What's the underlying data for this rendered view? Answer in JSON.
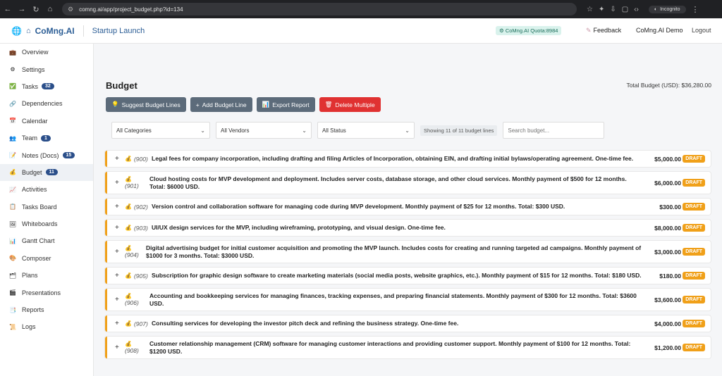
{
  "browser": {
    "url": "comng.ai/app/project_budget.php?id=134",
    "incognito_label": "Incognito"
  },
  "header": {
    "brand": "CoMng.AI",
    "project": "Startup Launch",
    "quota": "CoMng.AI Quota:8984",
    "feedback": "Feedback",
    "user": "CoMng.AI Demo",
    "logout": "Logout"
  },
  "sidebar": {
    "items": [
      {
        "label": "Overview",
        "icon": "briefcase-icon",
        "glyph": "💼",
        "badge": ""
      },
      {
        "label": "Settings",
        "icon": "gear-icon",
        "glyph": "⚙",
        "badge": ""
      },
      {
        "label": "Tasks",
        "icon": "checkbox-icon",
        "glyph": "✅",
        "badge": "32"
      },
      {
        "label": "Dependencies",
        "icon": "dependencies-icon",
        "glyph": "🔗",
        "badge": ""
      },
      {
        "label": "Calendar",
        "icon": "calendar-icon",
        "glyph": "📅",
        "badge": ""
      },
      {
        "label": "Team",
        "icon": "team-icon",
        "glyph": "👥",
        "badge": "1"
      },
      {
        "label": "Notes (Docs)",
        "icon": "notes-icon",
        "glyph": "📝",
        "badge": "15"
      },
      {
        "label": "Budget",
        "icon": "moneybag-icon",
        "glyph": "💰",
        "badge": "11"
      },
      {
        "label": "Activities",
        "icon": "activities-icon",
        "glyph": "📈",
        "badge": ""
      },
      {
        "label": "Tasks Board",
        "icon": "board-icon",
        "glyph": "📋",
        "badge": ""
      },
      {
        "label": "Whiteboards",
        "icon": "whiteboard-icon",
        "glyph": "🖼",
        "badge": ""
      },
      {
        "label": "Gantt Chart",
        "icon": "gantt-icon",
        "glyph": "📊",
        "badge": ""
      },
      {
        "label": "Composer",
        "icon": "composer-icon",
        "glyph": "🎨",
        "badge": ""
      },
      {
        "label": "Plans",
        "icon": "plans-icon",
        "glyph": "🗂",
        "badge": ""
      },
      {
        "label": "Presentations",
        "icon": "presentation-icon",
        "glyph": "🎬",
        "badge": ""
      },
      {
        "label": "Reports",
        "icon": "reports-icon",
        "glyph": "📑",
        "badge": ""
      },
      {
        "label": "Logs",
        "icon": "logs-icon",
        "glyph": "📜",
        "badge": ""
      }
    ],
    "active": "Budget"
  },
  "page": {
    "title": "Budget",
    "total": "Total Budget (USD): $36,280.00",
    "buttons": {
      "suggest": "Suggest Budget Lines",
      "add": "Add Budget Line",
      "export": "Export Report",
      "delete": "Delete Multiple"
    },
    "filters": {
      "categories": "All Categories",
      "vendors": "All Vendors",
      "status": "All Status",
      "showing": "Showing 11 of 11 budget lines",
      "search_placeholder": "Search budget..."
    }
  },
  "budget_lines": [
    {
      "id": "(900)",
      "desc": "Legal fees for company incorporation, including drafting and filing Articles of Incorporation, obtaining EIN, and drafting initial bylaws/operating agreement. One-time fee.",
      "amount": "$5,000.00",
      "status": "DRAFT"
    },
    {
      "id": "(901)",
      "desc": "Cloud hosting costs for MVP development and deployment. Includes server costs, database storage, and other cloud services. Monthly payment of $500 for 12 months. Total: $6000 USD.",
      "amount": "$6,000.00",
      "status": "DRAFT"
    },
    {
      "id": "(902)",
      "desc": "Version control and collaboration software for managing code during MVP development. Monthly payment of $25 for 12 months. Total: $300 USD.",
      "amount": "$300.00",
      "status": "DRAFT"
    },
    {
      "id": "(903)",
      "desc": "UI/UX design services for the MVP, including wireframing, prototyping, and visual design. One-time fee.",
      "amount": "$8,000.00",
      "status": "DRAFT"
    },
    {
      "id": "(904)",
      "desc": "Digital advertising budget for initial customer acquisition and promoting the MVP launch. Includes costs for creating and running targeted ad campaigns. Monthly payment of $1000 for 3 months. Total: $3000 USD.",
      "amount": "$3,000.00",
      "status": "DRAFT"
    },
    {
      "id": "(905)",
      "desc": "Subscription for graphic design software to create marketing materials (social media posts, website graphics, etc.). Monthly payment of $15 for 12 months. Total: $180 USD.",
      "amount": "$180.00",
      "status": "DRAFT"
    },
    {
      "id": "(906)",
      "desc": "Accounting and bookkeeping services for managing finances, tracking expenses, and preparing financial statements. Monthly payment of $300 for 12 months. Total: $3600 USD.",
      "amount": "$3,600.00",
      "status": "DRAFT"
    },
    {
      "id": "(907)",
      "desc": "Consulting services for developing the investor pitch deck and refining the business strategy. One-time fee.",
      "amount": "$4,000.00",
      "status": "DRAFT"
    },
    {
      "id": "(908)",
      "desc": "Customer relationship management (CRM) software for managing customer interactions and providing customer support. Monthly payment of $100 for 12 months. Total: $1200 USD.",
      "amount": "$1,200.00",
      "status": "DRAFT"
    }
  ],
  "colors": {
    "accent": "#f0a019",
    "brand": "#2b5d95",
    "danger": "#e03131"
  }
}
